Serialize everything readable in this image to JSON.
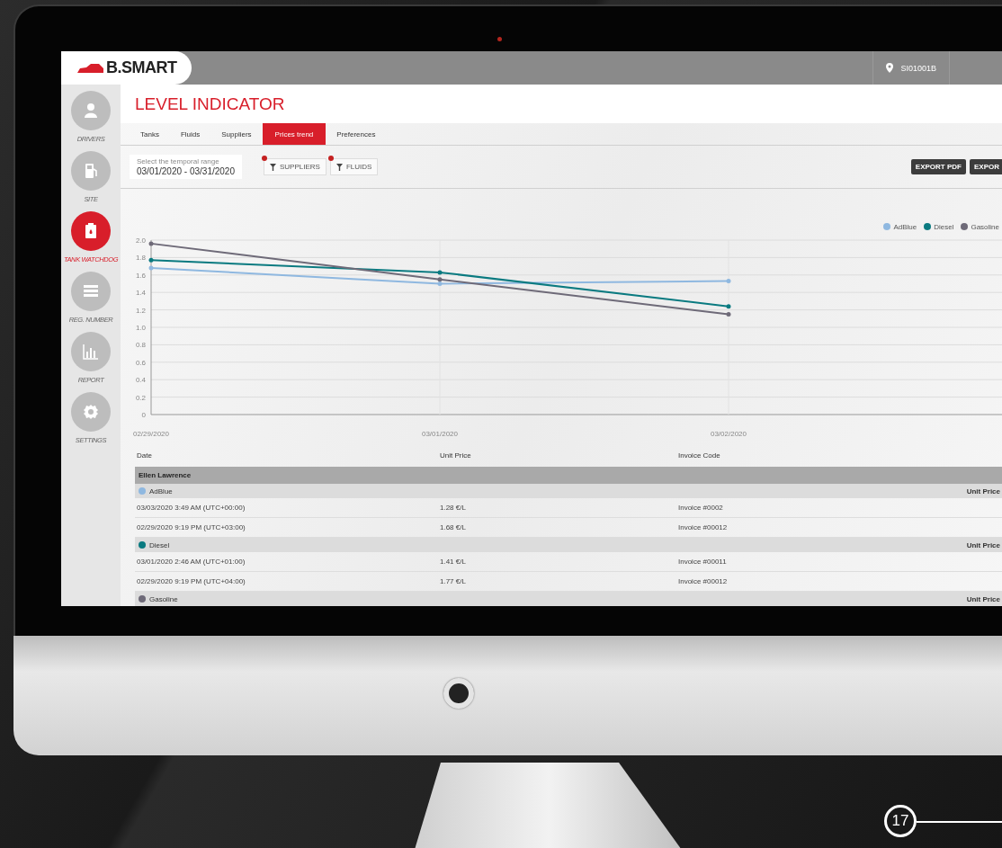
{
  "topbar": {
    "logo": "B.SMART",
    "location": "SI01001B"
  },
  "sidebar": {
    "items": [
      {
        "label": "DRIVERS",
        "kind": "person",
        "selected": false
      },
      {
        "label": "SITE",
        "kind": "pump",
        "selected": false
      },
      {
        "label": "TANK WATCHDOG",
        "kind": "tank",
        "selected": true
      },
      {
        "label": "REG. NUMBER",
        "kind": "list",
        "selected": false
      },
      {
        "label": "REPORT",
        "kind": "chart",
        "selected": false
      },
      {
        "label": "SETTINGS",
        "kind": "gear",
        "selected": false
      }
    ]
  },
  "page_title": "LEVEL INDICATOR",
  "tabs": [
    {
      "label": "Tanks",
      "selected": false
    },
    {
      "label": "Fluids",
      "selected": false
    },
    {
      "label": "Suppliers",
      "selected": false
    },
    {
      "label": "Prices trend",
      "selected": true
    },
    {
      "label": "Preferences",
      "selected": false
    }
  ],
  "date_range": {
    "label": "Select the temporal range",
    "value": "03/01/2020 - 03/31/2020"
  },
  "filters": [
    {
      "label": "SUPPLIERS",
      "active": true
    },
    {
      "label": "FLUIDS",
      "active": true
    }
  ],
  "export_buttons": [
    "EXPORT PDF",
    "EXPOR"
  ],
  "chart": {
    "chart_data": {
      "type": "line",
      "grid": true,
      "categories": [
        "02/29/2020",
        "03/01/2020",
        "03/02/2020"
      ],
      "ylim": [
        0,
        2
      ],
      "yticks": [
        {
          "value": 0,
          "label": "0"
        },
        {
          "value": 0.2,
          "label": "0.2"
        },
        {
          "value": 0.4,
          "label": "0.4"
        },
        {
          "value": 0.6,
          "label": "0.6"
        },
        {
          "value": 0.8,
          "label": "0.8"
        },
        {
          "value": 1,
          "label": "1.0"
        },
        {
          "value": 1.2,
          "label": "1.2"
        },
        {
          "value": 1.4,
          "label": "1.4"
        },
        {
          "value": 1.6,
          "label": "1.6"
        },
        {
          "value": 1.8,
          "label": "1.8"
        },
        {
          "value": 2,
          "label": "2.0"
        }
      ],
      "series": [
        {
          "name": "AdBlue",
          "color": "#8fb8e0",
          "values": [
            1.68,
            1.5,
            1.53
          ]
        },
        {
          "name": "Diesel",
          "color": "#0a7a80",
          "values": [
            1.77,
            1.63,
            1.24
          ]
        },
        {
          "name": "Gasoline",
          "color": "#6e6a78",
          "values": [
            1.96,
            1.55,
            1.15
          ]
        }
      ]
    }
  },
  "table": {
    "columns": [
      "Date",
      "Unit Price",
      "Invoice Code"
    ],
    "groups": [
      {
        "name": "Ellen Lawrence",
        "fluids": [
          {
            "name": "AdBlue",
            "color": "#8fb8e0",
            "column_label": "Unit Price",
            "rows": [
              {
                "date": "03/03/2020 3:49 AM (UTC+00:00)",
                "price": "1.28 €/L",
                "invoice": "Invoice #0002"
              },
              {
                "date": "02/29/2020 9:19 PM (UTC+03:00)",
                "price": "1.68 €/L",
                "invoice": "Invoice #00012"
              }
            ]
          },
          {
            "name": "Diesel",
            "color": "#0a7a80",
            "column_label": "Unit Price",
            "rows": [
              {
                "date": "03/01/2020 2:46 AM (UTC+01:00)",
                "price": "1.41 €/L",
                "invoice": "Invoice #00011"
              },
              {
                "date": "02/29/2020 9:19 PM (UTC+04:00)",
                "price": "1.77 €/L",
                "invoice": "Invoice #00012"
              }
            ]
          },
          {
            "name": "Gasoline",
            "color": "#6e6a78",
            "column_label": "Unit Price"
          }
        ]
      }
    ]
  },
  "badge": "17"
}
